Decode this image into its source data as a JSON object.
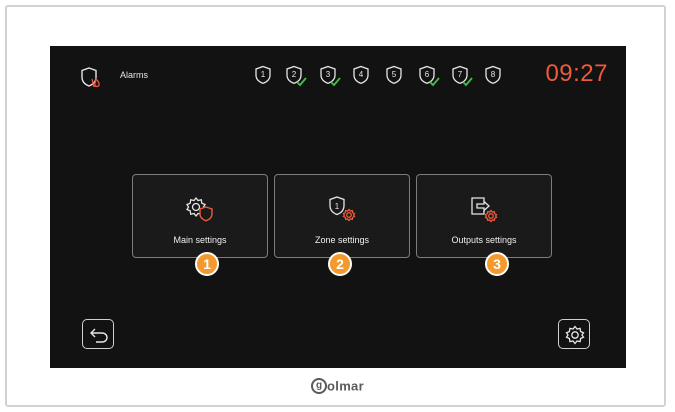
{
  "topbar": {
    "title": "Alarms",
    "time": "09:27",
    "zones": [
      {
        "num": "1",
        "ok": false
      },
      {
        "num": "2",
        "ok": true
      },
      {
        "num": "3",
        "ok": true
      },
      {
        "num": "4",
        "ok": false
      },
      {
        "num": "5",
        "ok": false
      },
      {
        "num": "6",
        "ok": true
      },
      {
        "num": "7",
        "ok": true
      },
      {
        "num": "8",
        "ok": false
      }
    ]
  },
  "menu": {
    "items": [
      {
        "label": "Main settings",
        "badge": "1",
        "icon": "gear-shield-icon"
      },
      {
        "label": "Zone settings",
        "badge": "2",
        "icon": "zone-gear-icon"
      },
      {
        "label": "Outputs settings",
        "badge": "3",
        "icon": "output-gear-icon"
      }
    ]
  },
  "buttons": {
    "back_icon": "back-arrow-icon",
    "settings_icon": "gear-icon"
  },
  "footer": {
    "brand_mark": "g",
    "brand_text": "olmar"
  },
  "colors": {
    "accent_orange": "#ef5a3a",
    "badge_orange": "#f29a2e",
    "ok_green": "#3fbf4a",
    "screen_bg": "#121212"
  }
}
